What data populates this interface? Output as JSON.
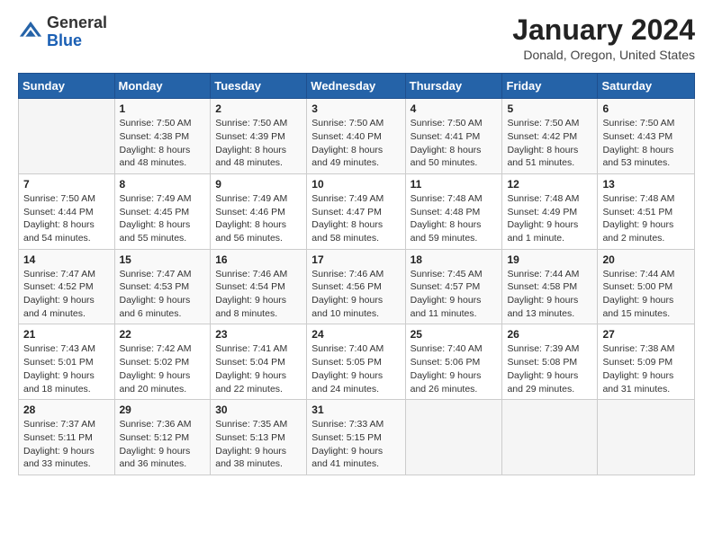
{
  "logo": {
    "general": "General",
    "blue": "Blue"
  },
  "header": {
    "title": "January 2024",
    "location": "Donald, Oregon, United States"
  },
  "weekdays": [
    "Sunday",
    "Monday",
    "Tuesday",
    "Wednesday",
    "Thursday",
    "Friday",
    "Saturday"
  ],
  "weeks": [
    [
      {
        "day": "",
        "sunrise": "",
        "sunset": "",
        "daylight": ""
      },
      {
        "day": "1",
        "sunrise": "Sunrise: 7:50 AM",
        "sunset": "Sunset: 4:38 PM",
        "daylight": "Daylight: 8 hours and 48 minutes."
      },
      {
        "day": "2",
        "sunrise": "Sunrise: 7:50 AM",
        "sunset": "Sunset: 4:39 PM",
        "daylight": "Daylight: 8 hours and 48 minutes."
      },
      {
        "day": "3",
        "sunrise": "Sunrise: 7:50 AM",
        "sunset": "Sunset: 4:40 PM",
        "daylight": "Daylight: 8 hours and 49 minutes."
      },
      {
        "day": "4",
        "sunrise": "Sunrise: 7:50 AM",
        "sunset": "Sunset: 4:41 PM",
        "daylight": "Daylight: 8 hours and 50 minutes."
      },
      {
        "day": "5",
        "sunrise": "Sunrise: 7:50 AM",
        "sunset": "Sunset: 4:42 PM",
        "daylight": "Daylight: 8 hours and 51 minutes."
      },
      {
        "day": "6",
        "sunrise": "Sunrise: 7:50 AM",
        "sunset": "Sunset: 4:43 PM",
        "daylight": "Daylight: 8 hours and 53 minutes."
      }
    ],
    [
      {
        "day": "7",
        "sunrise": "Sunrise: 7:50 AM",
        "sunset": "Sunset: 4:44 PM",
        "daylight": "Daylight: 8 hours and 54 minutes."
      },
      {
        "day": "8",
        "sunrise": "Sunrise: 7:49 AM",
        "sunset": "Sunset: 4:45 PM",
        "daylight": "Daylight: 8 hours and 55 minutes."
      },
      {
        "day": "9",
        "sunrise": "Sunrise: 7:49 AM",
        "sunset": "Sunset: 4:46 PM",
        "daylight": "Daylight: 8 hours and 56 minutes."
      },
      {
        "day": "10",
        "sunrise": "Sunrise: 7:49 AM",
        "sunset": "Sunset: 4:47 PM",
        "daylight": "Daylight: 8 hours and 58 minutes."
      },
      {
        "day": "11",
        "sunrise": "Sunrise: 7:48 AM",
        "sunset": "Sunset: 4:48 PM",
        "daylight": "Daylight: 8 hours and 59 minutes."
      },
      {
        "day": "12",
        "sunrise": "Sunrise: 7:48 AM",
        "sunset": "Sunset: 4:49 PM",
        "daylight": "Daylight: 9 hours and 1 minute."
      },
      {
        "day": "13",
        "sunrise": "Sunrise: 7:48 AM",
        "sunset": "Sunset: 4:51 PM",
        "daylight": "Daylight: 9 hours and 2 minutes."
      }
    ],
    [
      {
        "day": "14",
        "sunrise": "Sunrise: 7:47 AM",
        "sunset": "Sunset: 4:52 PM",
        "daylight": "Daylight: 9 hours and 4 minutes."
      },
      {
        "day": "15",
        "sunrise": "Sunrise: 7:47 AM",
        "sunset": "Sunset: 4:53 PM",
        "daylight": "Daylight: 9 hours and 6 minutes."
      },
      {
        "day": "16",
        "sunrise": "Sunrise: 7:46 AM",
        "sunset": "Sunset: 4:54 PM",
        "daylight": "Daylight: 9 hours and 8 minutes."
      },
      {
        "day": "17",
        "sunrise": "Sunrise: 7:46 AM",
        "sunset": "Sunset: 4:56 PM",
        "daylight": "Daylight: 9 hours and 10 minutes."
      },
      {
        "day": "18",
        "sunrise": "Sunrise: 7:45 AM",
        "sunset": "Sunset: 4:57 PM",
        "daylight": "Daylight: 9 hours and 11 minutes."
      },
      {
        "day": "19",
        "sunrise": "Sunrise: 7:44 AM",
        "sunset": "Sunset: 4:58 PM",
        "daylight": "Daylight: 9 hours and 13 minutes."
      },
      {
        "day": "20",
        "sunrise": "Sunrise: 7:44 AM",
        "sunset": "Sunset: 5:00 PM",
        "daylight": "Daylight: 9 hours and 15 minutes."
      }
    ],
    [
      {
        "day": "21",
        "sunrise": "Sunrise: 7:43 AM",
        "sunset": "Sunset: 5:01 PM",
        "daylight": "Daylight: 9 hours and 18 minutes."
      },
      {
        "day": "22",
        "sunrise": "Sunrise: 7:42 AM",
        "sunset": "Sunset: 5:02 PM",
        "daylight": "Daylight: 9 hours and 20 minutes."
      },
      {
        "day": "23",
        "sunrise": "Sunrise: 7:41 AM",
        "sunset": "Sunset: 5:04 PM",
        "daylight": "Daylight: 9 hours and 22 minutes."
      },
      {
        "day": "24",
        "sunrise": "Sunrise: 7:40 AM",
        "sunset": "Sunset: 5:05 PM",
        "daylight": "Daylight: 9 hours and 24 minutes."
      },
      {
        "day": "25",
        "sunrise": "Sunrise: 7:40 AM",
        "sunset": "Sunset: 5:06 PM",
        "daylight": "Daylight: 9 hours and 26 minutes."
      },
      {
        "day": "26",
        "sunrise": "Sunrise: 7:39 AM",
        "sunset": "Sunset: 5:08 PM",
        "daylight": "Daylight: 9 hours and 29 minutes."
      },
      {
        "day": "27",
        "sunrise": "Sunrise: 7:38 AM",
        "sunset": "Sunset: 5:09 PM",
        "daylight": "Daylight: 9 hours and 31 minutes."
      }
    ],
    [
      {
        "day": "28",
        "sunrise": "Sunrise: 7:37 AM",
        "sunset": "Sunset: 5:11 PM",
        "daylight": "Daylight: 9 hours and 33 minutes."
      },
      {
        "day": "29",
        "sunrise": "Sunrise: 7:36 AM",
        "sunset": "Sunset: 5:12 PM",
        "daylight": "Daylight: 9 hours and 36 minutes."
      },
      {
        "day": "30",
        "sunrise": "Sunrise: 7:35 AM",
        "sunset": "Sunset: 5:13 PM",
        "daylight": "Daylight: 9 hours and 38 minutes."
      },
      {
        "day": "31",
        "sunrise": "Sunrise: 7:33 AM",
        "sunset": "Sunset: 5:15 PM",
        "daylight": "Daylight: 9 hours and 41 minutes."
      },
      {
        "day": "",
        "sunrise": "",
        "sunset": "",
        "daylight": ""
      },
      {
        "day": "",
        "sunrise": "",
        "sunset": "",
        "daylight": ""
      },
      {
        "day": "",
        "sunrise": "",
        "sunset": "",
        "daylight": ""
      }
    ]
  ]
}
